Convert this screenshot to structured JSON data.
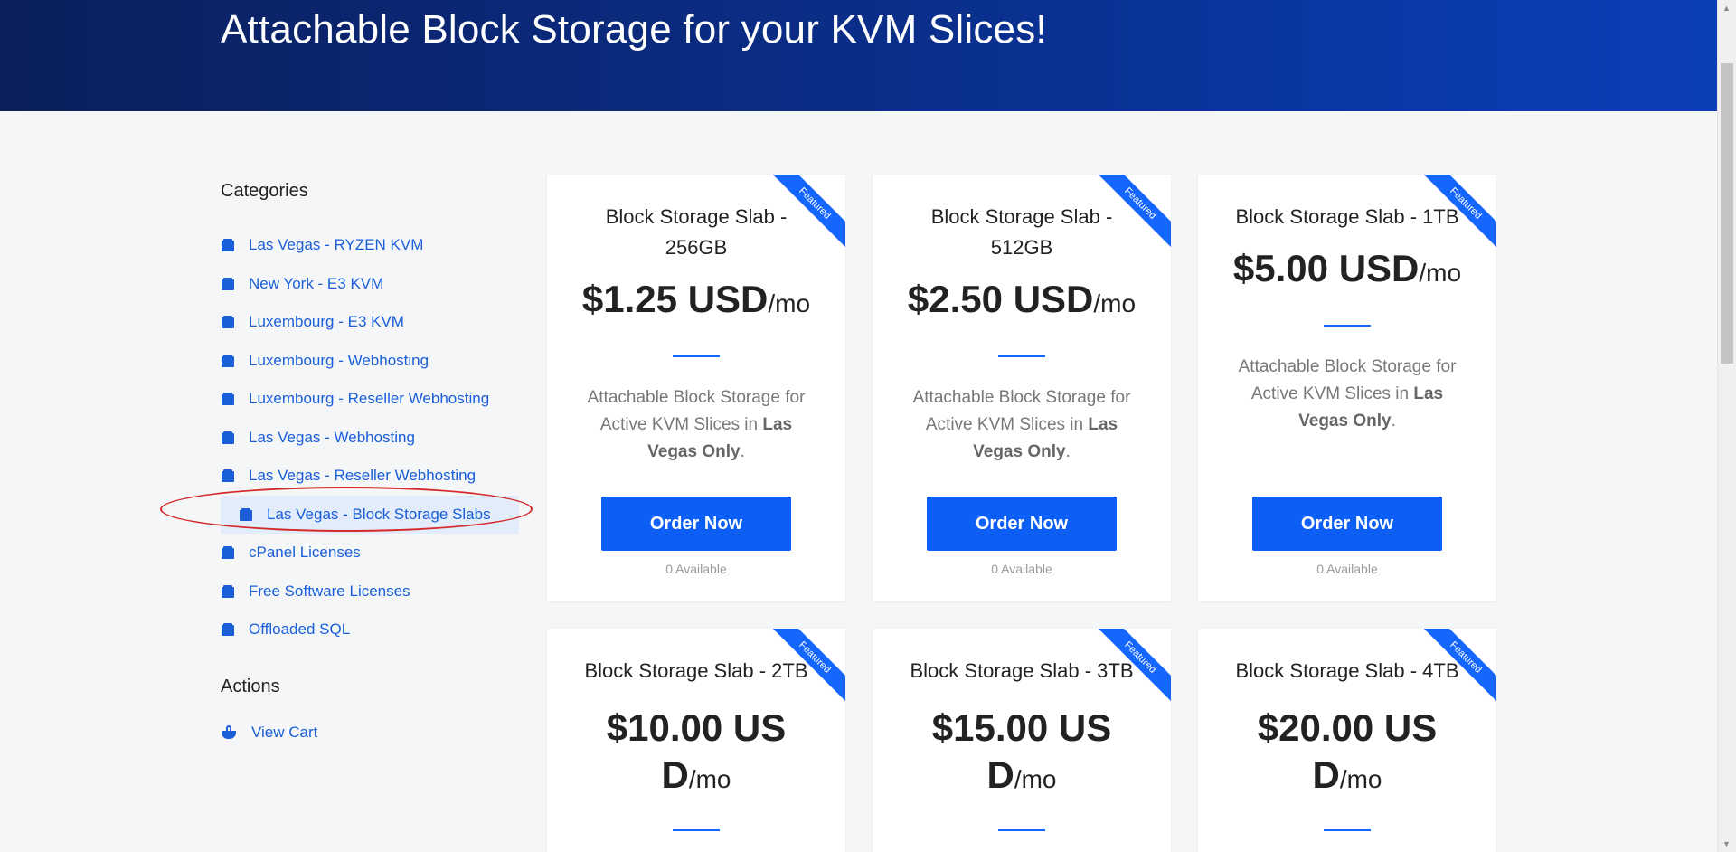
{
  "hero": {
    "title": "Attachable Block Storage for your KVM Slices!"
  },
  "sidebar": {
    "categories_heading": "Categories",
    "categories": [
      {
        "label": "Las Vegas - RYZEN KVM",
        "active": false
      },
      {
        "label": "New York - E3 KVM",
        "active": false
      },
      {
        "label": "Luxembourg - E3 KVM",
        "active": false
      },
      {
        "label": "Luxembourg - Webhosting",
        "active": false
      },
      {
        "label": "Luxembourg - Reseller Webhosting",
        "active": false
      },
      {
        "label": "Las Vegas - Webhosting",
        "active": false
      },
      {
        "label": "Las Vegas - Reseller Webhosting",
        "active": false
      },
      {
        "label": "Las Vegas - Block Storage Slabs",
        "active": true
      },
      {
        "label": "cPanel Licenses",
        "active": false
      },
      {
        "label": "Free Software Licenses",
        "active": false
      },
      {
        "label": "Offloaded SQL",
        "active": false
      }
    ],
    "actions_heading": "Actions",
    "view_cart_label": "View Cart"
  },
  "products": [
    {
      "ribbon": "Featured",
      "title_line1": "Block Storage Slab -",
      "title_line2": "256GB",
      "price": "$1.25 USD",
      "period": "/mo",
      "desc_line1": "Attachable Block Storage for",
      "desc_line2_a": "Active KVM Slices in ",
      "desc_line2_b": "Las",
      "desc_line3_b": "Vegas Only",
      "desc_line3_end": ".",
      "button": "Order Now",
      "availability": "0 Available"
    },
    {
      "ribbon": "Featured",
      "title_line1": "Block Storage Slab -",
      "title_line2": "512GB",
      "price": "$2.50 USD",
      "period": "/mo",
      "desc_line1": "Attachable Block Storage for",
      "desc_line2_a": "Active KVM Slices in ",
      "desc_line2_b": "Las",
      "desc_line3_b": "Vegas Only",
      "desc_line3_end": ".",
      "button": "Order Now",
      "availability": "0 Available"
    },
    {
      "ribbon": "Featured",
      "title_line1": "Block Storage Slab - 1TB",
      "price": "$5.00 USD",
      "period": "/mo",
      "desc_line1": "Attachable Block Storage for",
      "desc_line2_a": "Active KVM Slices in ",
      "desc_line2_b": "Las",
      "desc_line3_b": "Vegas Only",
      "desc_line3_end": ".",
      "button": "Order Now",
      "availability": "0 Available"
    },
    {
      "ribbon": "Featured",
      "title_line1": "Block Storage Slab - 2TB",
      "price_line1": "$10.00 US",
      "price_line2": "D",
      "period": "/mo"
    },
    {
      "ribbon": "Featured",
      "title_line1": "Block Storage Slab - 3TB",
      "price_line1": "$15.00 US",
      "price_line2": "D",
      "period": "/mo"
    },
    {
      "ribbon": "Featured",
      "title_line1": "Block Storage Slab - 4TB",
      "price_line1": "$20.00 US",
      "price_line2": "D",
      "period": "/mo"
    }
  ],
  "colors": {
    "accent": "#0d5ef5",
    "link": "#1a5fd8",
    "hero_dark": "#0b1f5c",
    "hero_light": "#0b3fb8",
    "annotation": "#d42a2a"
  }
}
